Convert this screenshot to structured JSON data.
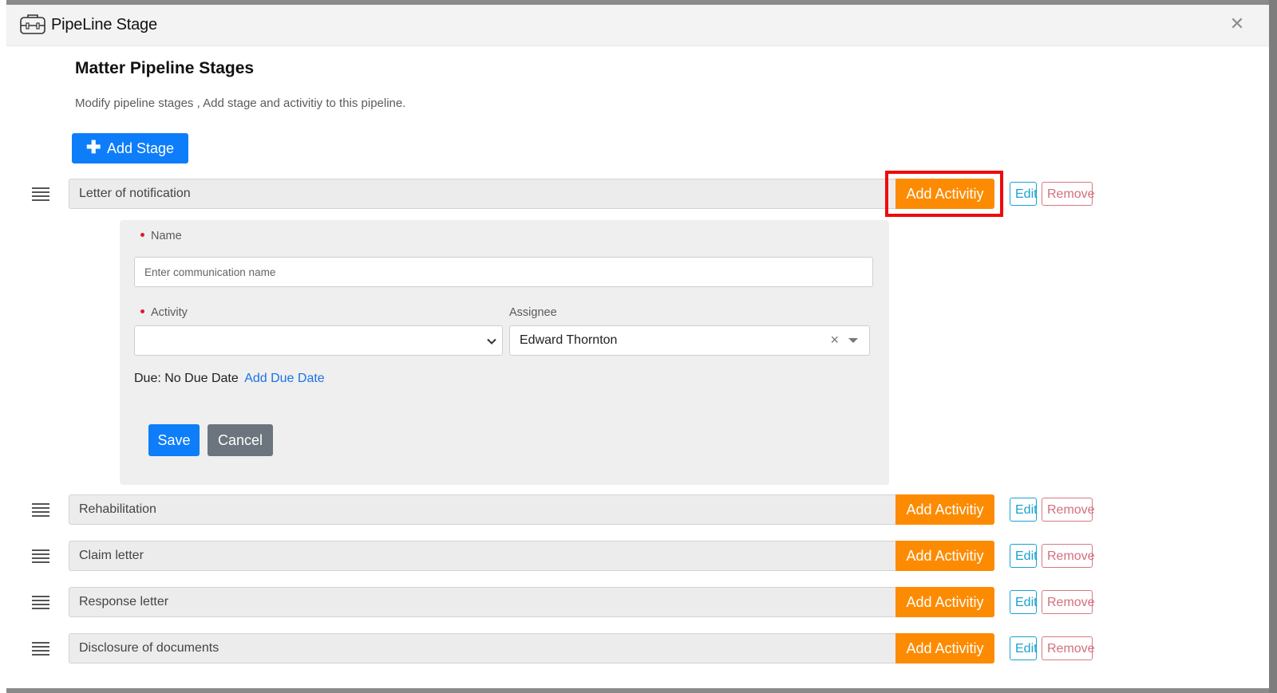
{
  "modal": {
    "title": "PipeLine Stage",
    "close_icon": "close-icon",
    "header_icon": "pipeline-toolbox-icon"
  },
  "section": {
    "title": "Matter Pipeline Stages",
    "subtitle": "Modify pipeline stages , Add stage and activitiy to this pipeline."
  },
  "toolbar": {
    "add_stage_label": "Add Stage",
    "add_stage_icon": "plus-icon"
  },
  "stage_actions": {
    "add_activity_label": "Add Activitiy",
    "edit_label": "Edit",
    "remove_label": "Remove"
  },
  "stages": [
    {
      "name": "Letter of notification",
      "expanded": true,
      "highlighted": true
    },
    {
      "name": "Rehabilitation"
    },
    {
      "name": "Claim letter"
    },
    {
      "name": "Response letter"
    },
    {
      "name": "Disclosure of documents"
    }
  ],
  "activity_form": {
    "name_label": "Name",
    "name_placeholder": "Enter communication name",
    "name_value": "",
    "activity_label": "Activity",
    "activity_value": "",
    "assignee_label": "Assignee",
    "assignee_value": "Edward Thornton",
    "due_text": "Due: No Due Date",
    "add_due_date_label": "Add Due Date",
    "save_label": "Save",
    "cancel_label": "Cancel"
  },
  "colors": {
    "primary": "#0d7dfa",
    "accent_orange": "#fd8b02",
    "edit_blue": "#18a2d2",
    "remove_red": "#d46f7c",
    "highlight_red": "#ee0b0b",
    "secondary_gray": "#6c757d"
  }
}
